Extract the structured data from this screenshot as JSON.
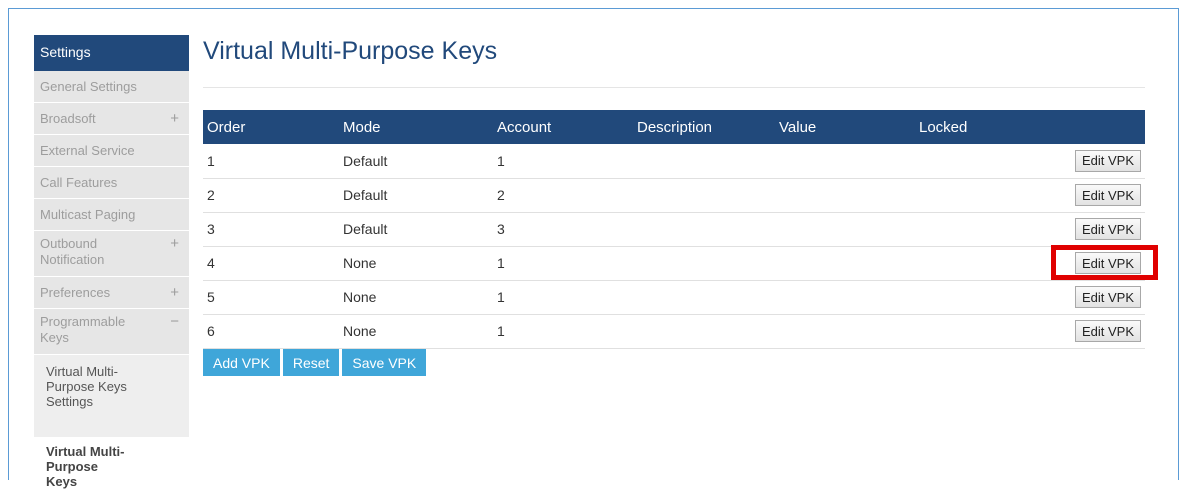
{
  "sidebar": {
    "header": "Settings",
    "items": [
      {
        "label": "General Settings",
        "sign": ""
      },
      {
        "label": "Broadsoft",
        "sign": "+"
      },
      {
        "label": "External Service",
        "sign": ""
      },
      {
        "label": "Call Features",
        "sign": ""
      },
      {
        "label": "Multicast Paging",
        "sign": ""
      },
      {
        "label": "Outbound Notification",
        "sign": "+"
      },
      {
        "label": "Preferences",
        "sign": "+"
      },
      {
        "label": "Programmable Keys",
        "sign": "−"
      }
    ],
    "sub_items": [
      {
        "label": "Virtual Multi-Purpose Keys Settings",
        "active": false
      },
      {
        "label": "Virtual Multi-Purpose Keys",
        "active": true
      }
    ]
  },
  "page": {
    "title": "Virtual Multi-Purpose Keys"
  },
  "table": {
    "columns": [
      "Order",
      "Mode",
      "Account",
      "Description",
      "Value",
      "Locked",
      ""
    ],
    "rows": [
      {
        "order": "1",
        "mode": "Default",
        "account": "1",
        "description": "",
        "value": "",
        "locked": "",
        "action": "Edit VPK"
      },
      {
        "order": "2",
        "mode": "Default",
        "account": "2",
        "description": "",
        "value": "",
        "locked": "",
        "action": "Edit VPK"
      },
      {
        "order": "3",
        "mode": "Default",
        "account": "3",
        "description": "",
        "value": "",
        "locked": "",
        "action": "Edit VPK"
      },
      {
        "order": "4",
        "mode": "None",
        "account": "1",
        "description": "",
        "value": "",
        "locked": "",
        "action": "Edit VPK"
      },
      {
        "order": "5",
        "mode": "None",
        "account": "1",
        "description": "",
        "value": "",
        "locked": "",
        "action": "Edit VPK"
      },
      {
        "order": "6",
        "mode": "None",
        "account": "1",
        "description": "",
        "value": "",
        "locked": "",
        "action": "Edit VPK"
      }
    ]
  },
  "actions": {
    "add": "Add VPK",
    "reset": "Reset",
    "save": "Save VPK"
  },
  "colors": {
    "header": "#21497b",
    "action_button": "#3fa6d9",
    "highlight": "#e00000"
  },
  "annotation": {
    "highlighted_row": 4
  }
}
